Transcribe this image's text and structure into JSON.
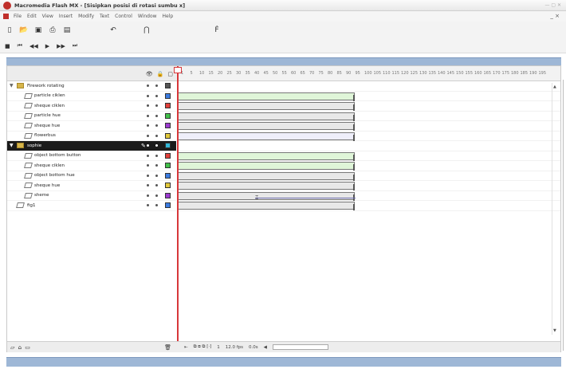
{
  "window": {
    "title": "Macromedia Flash MX - [Sisipkan posisi di rotasi sumbu x]",
    "title_right": "— ▢ ✕"
  },
  "menubar": {
    "items": [
      "File",
      "Edit",
      "View",
      "Insert",
      "Modify",
      "Text",
      "Control",
      "Window",
      "Help"
    ],
    "controls": "_ ×"
  },
  "toolbar1": {
    "icons": [
      "new-icon",
      "open-icon",
      "save-icon",
      "print-icon",
      "preview-icon",
      "undo-icon",
      "snap-icon",
      "text-tool-icon"
    ]
  },
  "toolbar2": {
    "icons": [
      "stop-icon",
      "rewind-icon",
      "step-back-icon",
      "play-icon",
      "step-forward-icon",
      "end-icon"
    ]
  },
  "timeline": {
    "header_icons": [
      "eye-icon",
      "lock-icon",
      "outline-icon"
    ],
    "frame_numbers": [
      "1",
      "5",
      "10",
      "15",
      "20",
      "25",
      "30",
      "35",
      "40",
      "45",
      "50",
      "55",
      "60",
      "65",
      "70",
      "75",
      "80",
      "85",
      "90",
      "95",
      "100",
      "105",
      "110",
      "115",
      "120",
      "125",
      "130",
      "135",
      "140",
      "145",
      "150",
      "155",
      "160",
      "165",
      "170",
      "175",
      "180",
      "185",
      "190",
      "195"
    ],
    "layers": [
      {
        "name": "Firework rotating",
        "type": "folder",
        "color": "#555555",
        "tween": null,
        "selected": false
      },
      {
        "name": "particle ciklen",
        "type": "layer",
        "color": "#3b7be0",
        "tween": "green",
        "selected": false
      },
      {
        "name": "sheque ciklen",
        "type": "layer",
        "color": "#e0403b",
        "tween": "gray",
        "selected": false
      },
      {
        "name": "particle hue",
        "type": "layer",
        "color": "#42c04a",
        "tween": "gray",
        "selected": false
      },
      {
        "name": "sheque hue",
        "type": "layer",
        "color": "#9b3bd0",
        "tween": "gray",
        "selected": false
      },
      {
        "name": "flowerbus",
        "type": "layer",
        "color": "#e0c83b",
        "tween": "lav",
        "selected": false
      },
      {
        "name": "sophie",
        "type": "folder",
        "color": "#32b8d8",
        "tween": null,
        "selected": true
      },
      {
        "name": "object bottom button",
        "type": "layer",
        "color": "#e0403b",
        "tween": "green",
        "selected": false
      },
      {
        "name": "sheque ciklen",
        "type": "layer",
        "color": "#42c04a",
        "tween": "green",
        "selected": false
      },
      {
        "name": "object bottom hue",
        "type": "layer",
        "color": "#3b7be0",
        "tween": "gray",
        "selected": false
      },
      {
        "name": "sheque hue",
        "type": "layer",
        "color": "#e0c83b",
        "tween": "gray",
        "selected": false
      },
      {
        "name": "sheme",
        "type": "layer",
        "color": "#9b3bd0",
        "tween": "gray-mid",
        "selected": false
      },
      {
        "name": "fig1",
        "type": "layer",
        "color": "#3b7be0",
        "tween": "gray",
        "selected": false
      }
    ],
    "footer_left": "▱ ⌂ ▭",
    "footer_trash": "🗑",
    "footer_right": {
      "btn1": "⇤",
      "onion": "⧉ ⧈ ⧉ [·]",
      "frame": "1",
      "fps": "12.0 fps",
      "time": "0.0s"
    }
  }
}
